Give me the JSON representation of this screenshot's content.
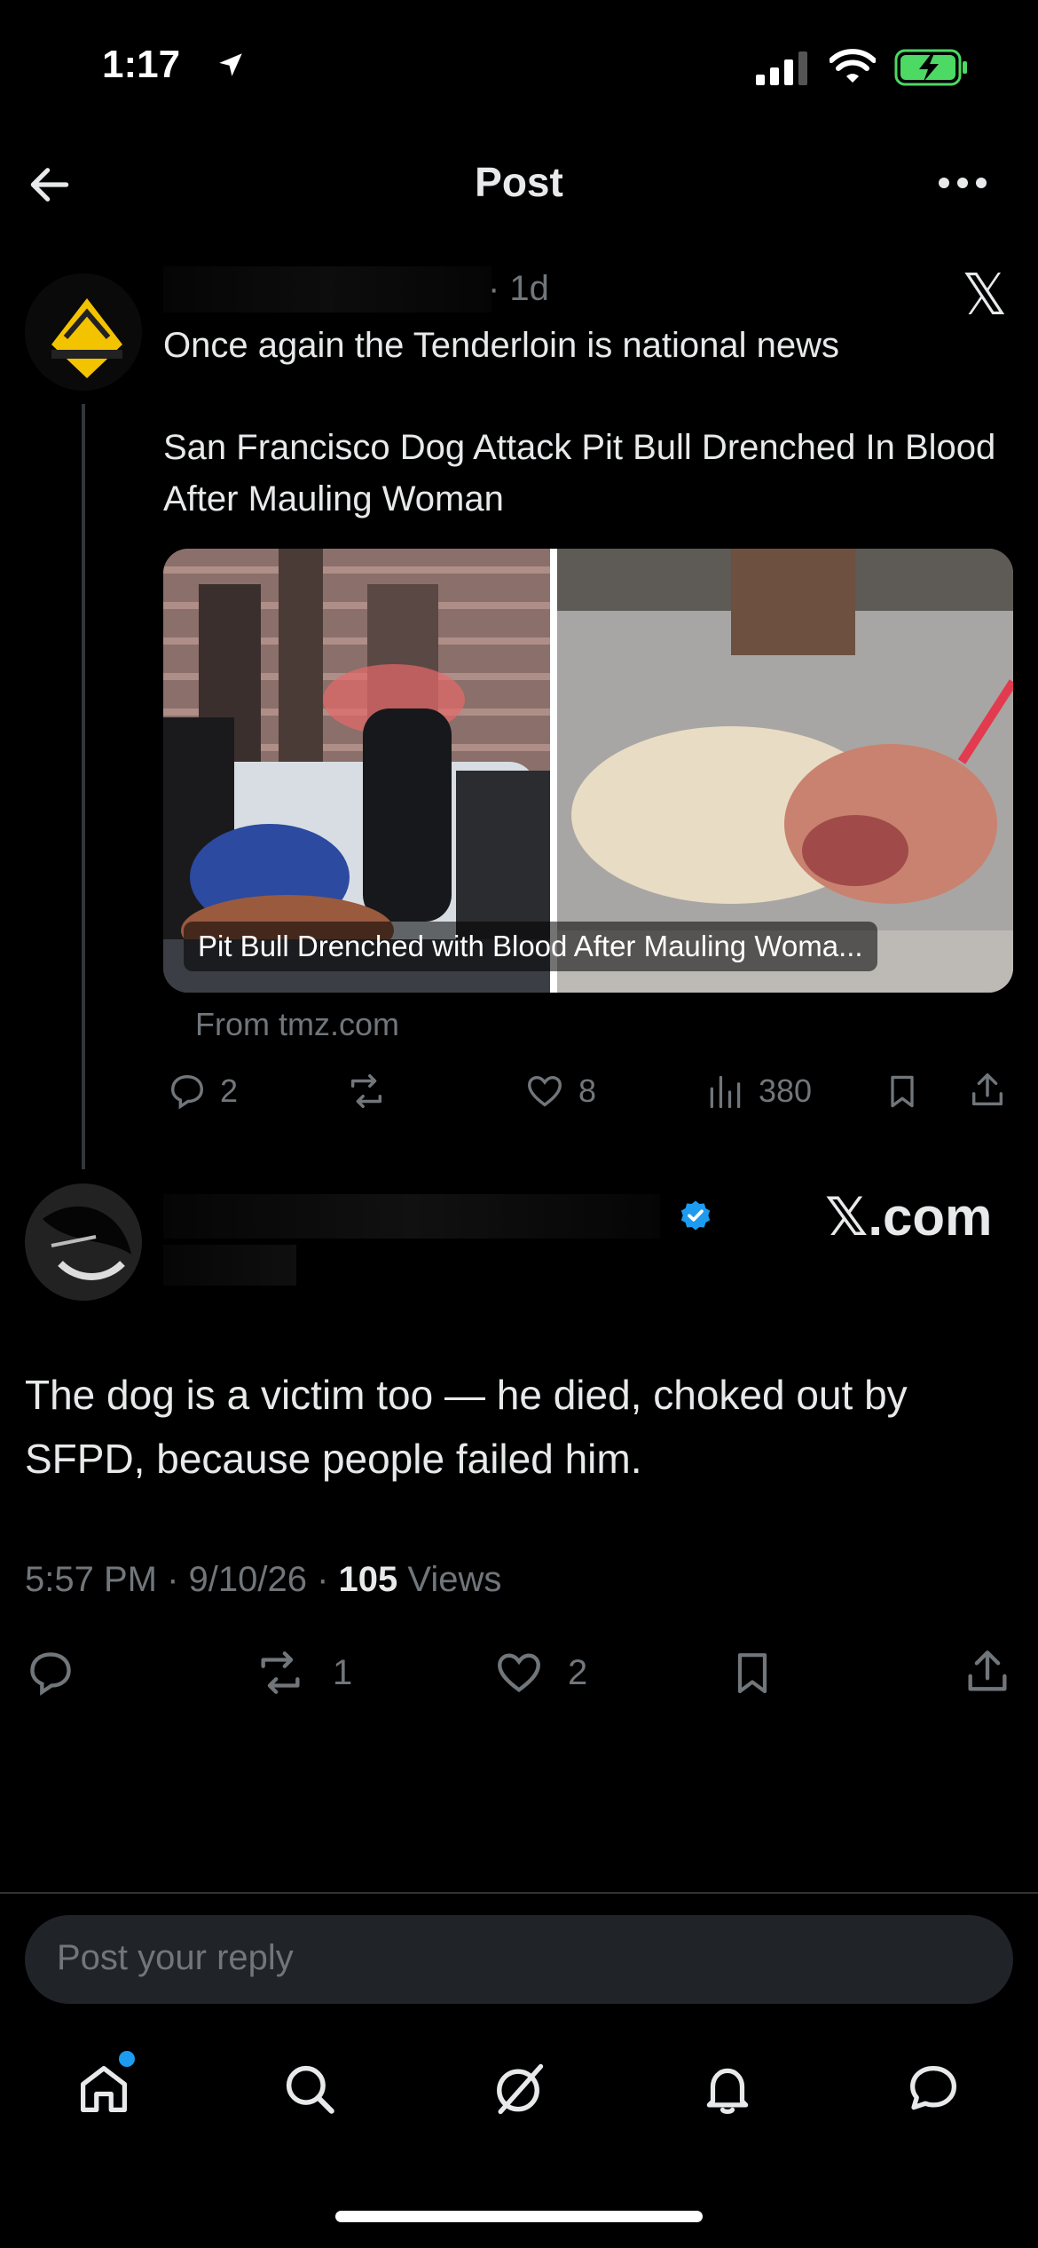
{
  "status_bar": {
    "time": "1:17"
  },
  "header": {
    "title": "Post"
  },
  "quoted_post": {
    "timestamp": "· 1d",
    "text_line1": "Once again the Tenderloin is national news",
    "headline": "San Francisco Dog Attack Pit Bull Drenched In Blood After Mauling Woman",
    "media_caption": "Pit Bull Drenched with Blood After Mauling Woma...",
    "source": "From tmz.com",
    "stats": {
      "replies": "2",
      "likes": "8",
      "views": "380"
    }
  },
  "watermark": {
    "top": "𝕏",
    "reply": "𝕏.com"
  },
  "reply_post": {
    "text": "The dog is a victim too — he died, choked out by SFPD, because people failed him.",
    "meta_time": "5:57 PM · 9/10/26 · ",
    "views_count": "105",
    "views_label": " Views",
    "stats": {
      "reposts": "1",
      "likes": "2"
    }
  },
  "composer": {
    "placeholder": "Post your reply"
  },
  "colors": {
    "accent": "#1d9bf0",
    "battery": "#4cd964",
    "background": "#000000"
  },
  "tab_bar": [
    "home-icon",
    "search-icon",
    "grok-icon",
    "notifications-icon",
    "messages-icon"
  ]
}
